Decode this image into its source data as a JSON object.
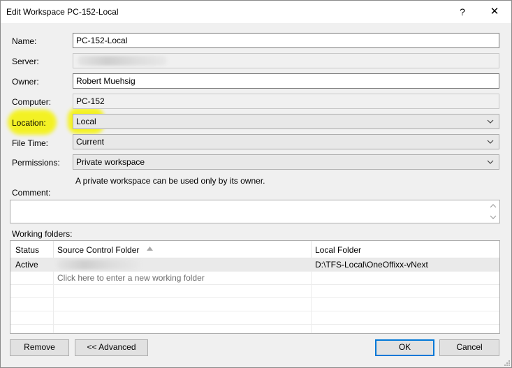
{
  "window": {
    "title": "Edit Workspace PC-152-Local",
    "help_glyph": "?",
    "close_glyph": "✕"
  },
  "form": {
    "name_label": "Name:",
    "name_value": "PC-152-Local",
    "server_label": "Server:",
    "server_value": "",
    "owner_label": "Owner:",
    "owner_value": "Robert Muehsig",
    "computer_label": "Computer:",
    "computer_value": "PC-152",
    "location_label": "Location:",
    "location_value": "Local",
    "filetime_label": "File Time:",
    "filetime_value": "Current",
    "permissions_label": "Permissions:",
    "permissions_value": "Private workspace",
    "permissions_hint": "A private workspace can be used only by its owner.",
    "comment_label": "Comment:",
    "comment_value": ""
  },
  "working_folders": {
    "label": "Working folders:",
    "columns": [
      "Status",
      "Source Control Folder",
      "Local Folder"
    ],
    "rows": [
      {
        "status": "Active",
        "source": "",
        "local": "D:\\TFS-Local\\OneOffixx-vNext"
      }
    ],
    "new_row_prompt": "Click here to enter a new working folder"
  },
  "buttons": {
    "remove": "Remove",
    "advanced": "<< Advanced",
    "ok": "OK",
    "cancel": "Cancel"
  },
  "colors": {
    "highlight": "#f4f21a",
    "default_button_border": "#0078d7"
  }
}
